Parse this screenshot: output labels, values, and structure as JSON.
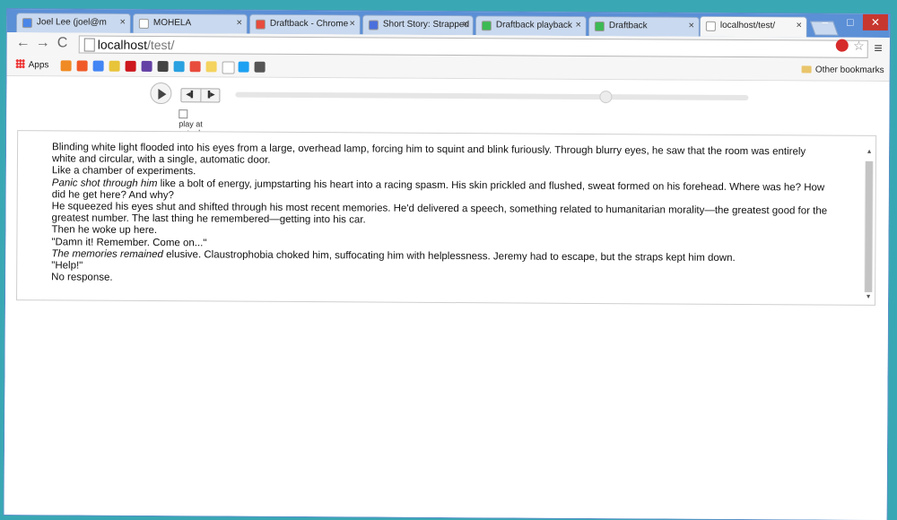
{
  "tabs": [
    {
      "label": "Joel Lee (joel@m",
      "color": "#4a86e8"
    },
    {
      "label": "MOHELA",
      "color": "#ffffff"
    },
    {
      "label": "Draftback - Chrome",
      "color": "#e74c3c"
    },
    {
      "label": "Short Story: Strapped",
      "color": "#4a6fdc"
    },
    {
      "label": "Draftback playback",
      "color": "#3cba54"
    },
    {
      "label": "Draftback",
      "color": "#3cba54"
    },
    {
      "label": "localhost/test/",
      "color": "#ffffff"
    }
  ],
  "address": {
    "host": "localhost",
    "path": "/test/"
  },
  "bookmarks": {
    "apps_label": "Apps",
    "icon_colors": [
      "#f08a24",
      "#f05a28",
      "#4285f4",
      "#e8c43a",
      "#cc181e",
      "#6441a5",
      "#444444",
      "#2aa1e0",
      "#e84c3d",
      "#f4d35e",
      "#ffffff",
      "#1da1f2",
      "#555555"
    ],
    "other_label": "Other bookmarks"
  },
  "player": {
    "checkbox_label": "play at actual speed?",
    "progress": 0.72
  },
  "document": {
    "paragraphs": [
      {
        "text": "Blinding white light flooded into his eyes from a large, overhead lamp, forcing him to squint and blink furiously. Through blurry eyes, he saw that the room was entirely white and circular, with a single, automatic door.",
        "italic": false
      },
      {
        "text": "Like a chamber of experiments.",
        "italic": false
      },
      {
        "text": "Panic shot through him like a bolt of energy, jumpstarting his heart into a racing spasm. His skin prickled and flushed, sweat formed on his forehead. Where was he? How did he get here? And why?",
        "italic": false,
        "italic_prefix": "Panic shot through him"
      },
      {
        "text": "He squeezed his eyes shut and shifted through his most recent memories. He'd delivered a speech, something related to humanitarian morality—the greatest good for the greatest number. The last thing he remembered—getting into his car.",
        "italic": false
      },
      {
        "text": "Then he woke up here.",
        "italic": false
      },
      {
        "text": "\"Damn it! Remember. Come on...\"",
        "italic": false
      },
      {
        "text": "The memories remained elusive. Claustrophobia choked him, suffocating him with helplessness. Jeremy had to escape, but the straps kept him down.",
        "italic": false,
        "italic_prefix": "The memories remained"
      },
      {
        "text": "\"Help!\"",
        "italic": false
      },
      {
        "text": "No response.",
        "italic": false
      }
    ]
  }
}
